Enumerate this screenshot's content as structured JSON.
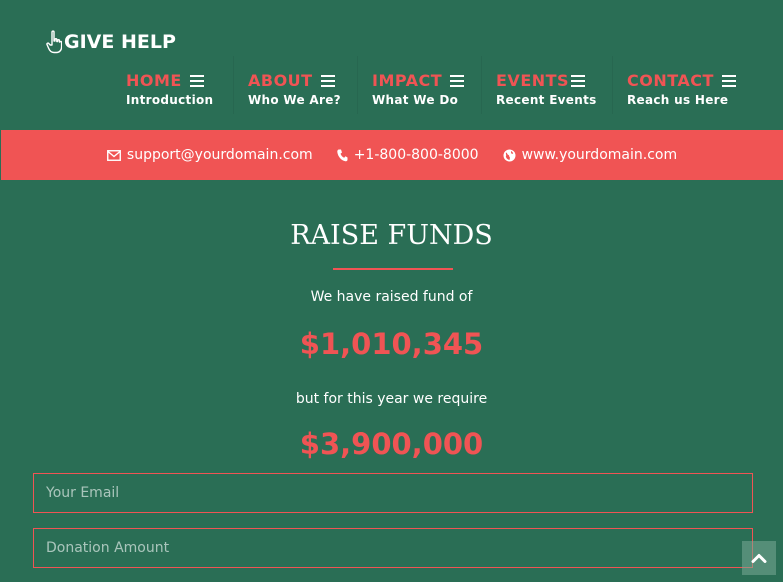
{
  "brand": {
    "name": "GIVE HELP",
    "icon": "hand-pointing-up-icon"
  },
  "nav": [
    {
      "title": "HOME",
      "subtitle": "Introduction"
    },
    {
      "title": "ABOUT",
      "subtitle": "Who We Are?"
    },
    {
      "title": "IMPACT",
      "subtitle": "What We Do"
    },
    {
      "title": "EVENTS",
      "subtitle": "Recent Events"
    },
    {
      "title": "CONTACT",
      "subtitle": "Reach us Here"
    }
  ],
  "contact": {
    "email": "support@yourdomain.com",
    "phone": "+1-800-800-8000",
    "website": "www.yourdomain.com"
  },
  "main": {
    "title": "RAISE FUNDS",
    "raised_text": "We have raised fund of",
    "raised_amount": "$1,010,345",
    "require_text": "but for this year we require",
    "require_amount": "$3,900,000"
  },
  "form": {
    "email_placeholder": "Your Email",
    "amount_placeholder": "Donation Amount"
  },
  "colors": {
    "background": "#2a6e55",
    "accent": "#f05454",
    "text": "#ffffff"
  }
}
